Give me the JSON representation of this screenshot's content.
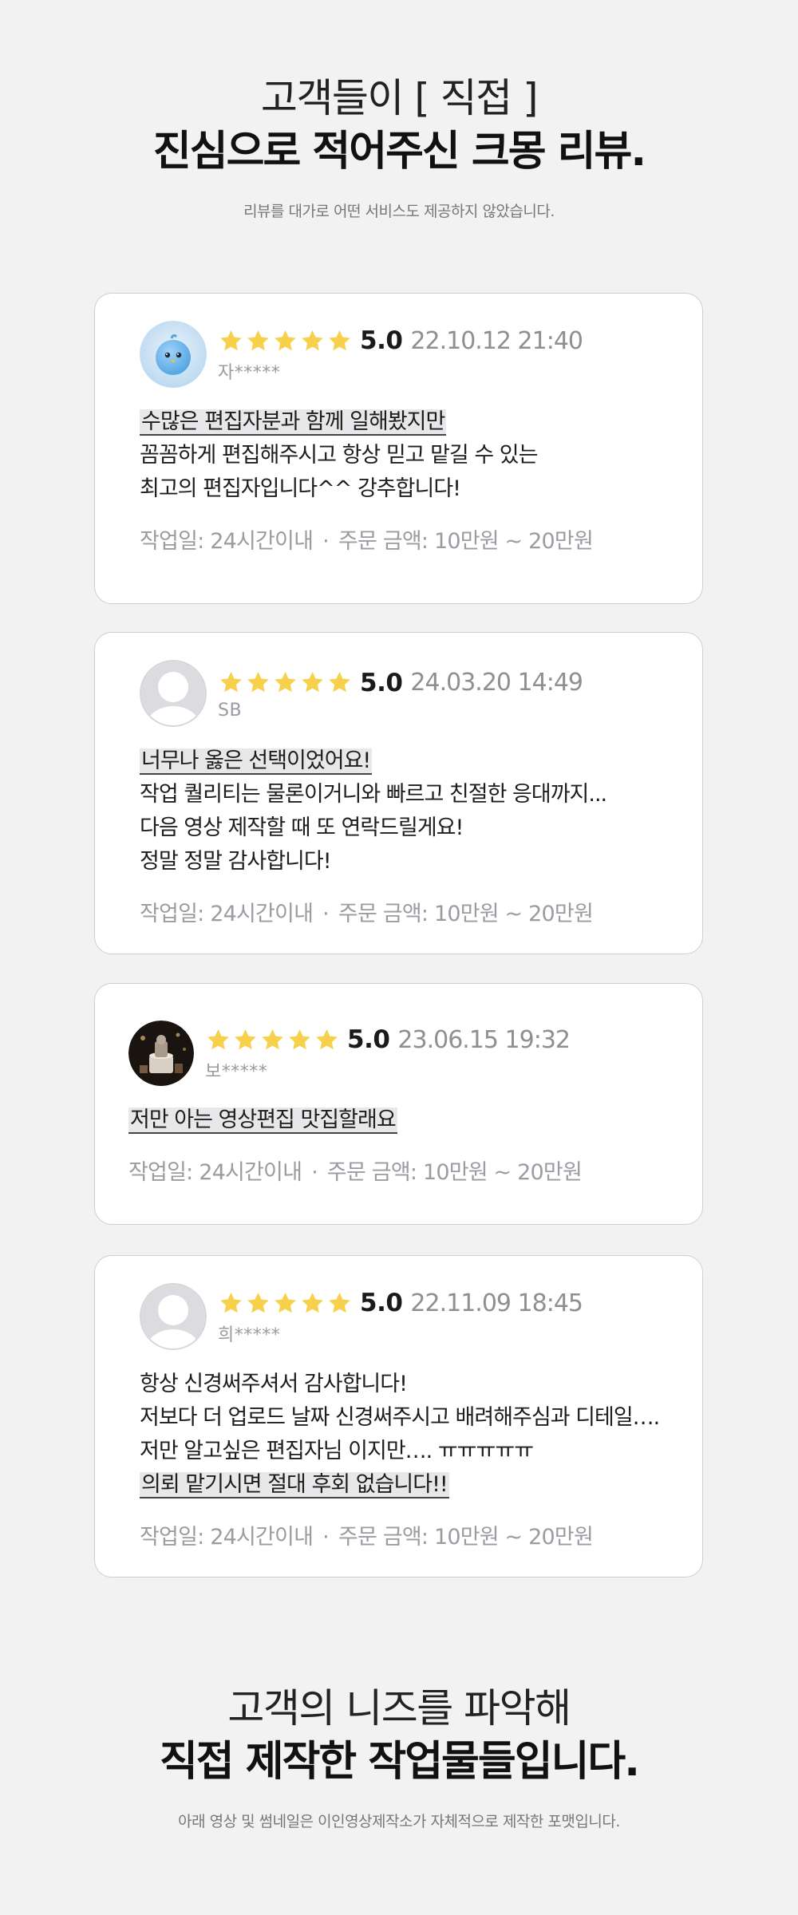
{
  "top_section": {
    "title_light": "고객들이 [ 직접 ]",
    "title_bold": "진심으로 적어주신 크몽 리뷰.",
    "subtitle": "리뷰를 대가로 어떤 서비스도 제공하지 않았습니다."
  },
  "reviews": [
    {
      "avatar": "blue-bird-icon",
      "rating": 5,
      "score": "5.0",
      "date": "22.10.12 21:40",
      "author": "자*****",
      "lines": [
        "수많은 편집자분과 함께 일해봤지만",
        "꼼꼼하게 편집해주시고 항상 믿고 맡길 수 있는",
        "최고의 편집자입니다^^ 강추합니다!"
      ],
      "highlight_line": 0,
      "work_period": "작업일: 24시간이내",
      "order_amount": "주문 금액: 10만원 ~ 20만원"
    },
    {
      "avatar": "default-user-icon",
      "rating": 5,
      "score": "5.0",
      "date": "24.03.20 14:49",
      "author": "SB",
      "lines": [
        "너무나 옳은 선택이었어요!",
        "작업 퀄리티는 물론이거니와 빠르고 친절한 응대까지...",
        "다음 영상 제작할 때 또 연락드릴게요!",
        "정말 정말 감사합니다!"
      ],
      "highlight_line": 0,
      "work_period": "작업일: 24시간이내",
      "order_amount": "주문 금액: 10만원 ~ 20만원"
    },
    {
      "avatar": "photo-avatar-icon",
      "rating": 5,
      "score": "5.0",
      "date": "23.06.15 19:32",
      "author": "보*****",
      "lines": [
        "저만 아는 영상편집 맛집할래요"
      ],
      "highlight_line": 0,
      "work_period": "작업일: 24시간이내",
      "order_amount": "주문 금액: 10만원 ~ 20만원"
    },
    {
      "avatar": "default-user-icon",
      "rating": 5,
      "score": "5.0",
      "date": "22.11.09 18:45",
      "author": "희*****",
      "lines": [
        "항상 신경써주셔서 감사합니다!",
        "저보다 더 업로드 날짜 신경써주시고 배려해주심과 디테일….",
        "저만 알고싶은 편집자님 이지만…. ㅠㅠㅠㅠㅠ",
        "의뢰 맡기시면 절대 후회 없습니다!!"
      ],
      "highlight_line": 3,
      "work_period": "작업일: 24시간이내",
      "order_amount": "주문 금액: 10만원 ~ 20만원"
    }
  ],
  "bottom_section": {
    "title_light": "고객의 니즈를 파악해",
    "title_bold": "직접 제작한 작업물들입니다.",
    "subtitle": "아래 영상 및 썸네일은 이인영상제작소가 자체적으로 제작한 포맷입니다."
  },
  "colors": {
    "background": "#f2f2f3",
    "star": "#f7d14b",
    "card_border": "#cfcfd2",
    "muted_text": "#9b9ba1",
    "highlight_bg": "#e8e8ea"
  }
}
